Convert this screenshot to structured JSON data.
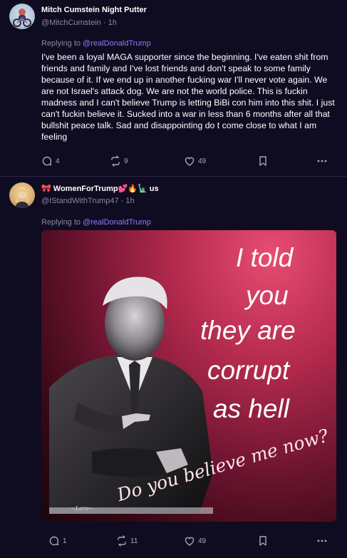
{
  "posts": [
    {
      "author": {
        "display_name": "Mitch Cumstein Night Putter",
        "handle": "@MitchCumstein",
        "time": "1h"
      },
      "reply_prefix": "Replying to ",
      "reply_to": "@realDonaldTrump",
      "body": "I've been a loyal MAGA supporter since the beginning. I've eaten shit from friends and family and I've lost friends and don't speak to some family because of it. If we end up in another fucking war I'll never vote again. We are not Israel's attack dog. We are not the world police. This is fuckin madness and I can't believe Trump is letting BiBi con him into this shit. I just can't fuckin believe it. Sucked into a war in less than 6 months after all that bullshit peace talk. Sad and disappointing do t come close to what I am feeling",
      "actions": {
        "replies": "4",
        "reposts": "9",
        "likes": "49"
      },
      "avatar_icon": "motorcycle-icon"
    },
    {
      "author": {
        "display_name_prefix_emoji": "🎀",
        "display_name": "WomenForTrump",
        "display_name_suffix_emoji": "💕🔥🗽",
        "suffix_text": "us",
        "handle": "@IStandWithTrump47",
        "time": "1h"
      },
      "reply_prefix": "Replying to ",
      "reply_to": "@realDonaldTrump",
      "image": {
        "overlay_lines": [
          "I told",
          "you",
          "they are",
          "corrupt",
          "as hell"
        ],
        "script_text": "Do you believe me now?",
        "signature": "~Lora~",
        "colors": {
          "accent": "#e94c72",
          "dark": "#1a060b"
        }
      },
      "actions": {
        "replies": "1",
        "reposts": "11",
        "likes": "49"
      }
    }
  ],
  "icons": {
    "reply": "reply-icon",
    "repost": "repost-icon",
    "like": "heart-icon",
    "bookmark": "bookmark-icon",
    "more": "more-icon"
  },
  "colors": {
    "background": "#0f0c21",
    "mention": "#8f7bff",
    "muted": "#8a86a3",
    "divider": "#2c2846"
  }
}
